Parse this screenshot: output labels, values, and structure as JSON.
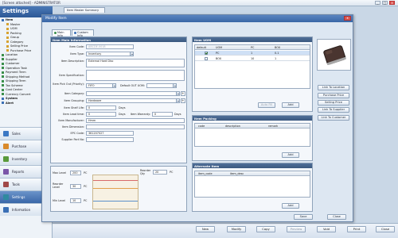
{
  "app": {
    "title": "[Screen attached] - ADMINISTRATOR",
    "min": "_",
    "max": "□",
    "close": "x"
  },
  "sidebar": {
    "header": "Settings",
    "tree": [
      {
        "label": "Item",
        "bold": true,
        "indent": 0,
        "color": "#3a6fb5"
      },
      {
        "label": "Master",
        "indent": 1,
        "color": "#d7a230"
      },
      {
        "label": "UOM",
        "indent": 1,
        "color": "#d7a230"
      },
      {
        "label": "Packing",
        "indent": 1,
        "color": "#d7a230"
      },
      {
        "label": "Group",
        "indent": 1,
        "color": "#d7a230"
      },
      {
        "label": "Category",
        "indent": 1,
        "color": "#d7a230"
      },
      {
        "label": "Selling Price",
        "indent": 1,
        "color": "#d7a230"
      },
      {
        "label": "Purchase Price",
        "indent": 1,
        "color": "#d7a230"
      },
      {
        "label": "Location",
        "indent": 0,
        "color": "#3a8f4a"
      },
      {
        "label": "Supplier",
        "indent": 0,
        "color": "#3a8f4a"
      },
      {
        "label": "Customer",
        "indent": 0,
        "color": "#3a8f4a"
      },
      {
        "label": "Operation Task",
        "indent": 0,
        "color": "#3a8f4a"
      },
      {
        "label": "Payment Term",
        "indent": 0,
        "color": "#3a8f4a"
      },
      {
        "label": "Shipping Method",
        "indent": 0,
        "color": "#3a8f4a"
      },
      {
        "label": "Shipping Term",
        "indent": 0,
        "color": "#3a8f4a"
      },
      {
        "label": "Tax Scheme",
        "indent": 0,
        "color": "#3a8f4a"
      },
      {
        "label": "Cost Center",
        "indent": 0,
        "color": "#3a8f4a"
      },
      {
        "label": "Currency Convert",
        "indent": 0,
        "color": "#3a8f4a"
      },
      {
        "label": "System",
        "bold": true,
        "indent": 0,
        "color": "#3a6fb5"
      },
      {
        "label": "Alert",
        "bold": true,
        "indent": 0,
        "color": "#3a6fb5"
      }
    ],
    "nav": [
      {
        "label": "Sales",
        "color": "#3b78c4"
      },
      {
        "label": "Purchase",
        "color": "#d98a2b"
      },
      {
        "label": "Inventory",
        "color": "#5a9a3b"
      },
      {
        "label": "Reports",
        "color": "#7a55a8"
      },
      {
        "label": "Tools",
        "color": "#a04848"
      },
      {
        "label": "Settings",
        "color": "#2f8aa0",
        "active": true
      },
      {
        "label": "Information",
        "color": "#3a6fb5"
      }
    ]
  },
  "background": {
    "tab": "Item Master Summary",
    "buttons": [
      {
        "label": "New",
        "disabled": false
      },
      {
        "label": "Modify",
        "disabled": false
      },
      {
        "label": "Copy",
        "disabled": false
      },
      {
        "label": "Preview",
        "disabled": true
      },
      {
        "label": "Void",
        "disabled": false
      },
      {
        "label": "Print",
        "disabled": false
      },
      {
        "label": "Close",
        "disabled": false
      }
    ]
  },
  "modal": {
    "title": "Modify Item",
    "tabs": [
      {
        "label": "Main Info",
        "active": true,
        "color": "#3a8f4a"
      },
      {
        "label": "Custom Info",
        "active": false,
        "color": "#3a6fb5"
      }
    ],
    "main_info": {
      "header": "Item Main Information",
      "item_code_label": "Item Code:",
      "item_code_value": "ABCDE-0018",
      "item_type_label": "Item Type:",
      "item_type_value": "Inventory",
      "item_desc_label": "Item Description:",
      "item_desc_value": "External Hard Disc",
      "item_spec_label": "Item Specification:",
      "pick_out_label": "Item Pick Out (Priority):",
      "pick_out_value": "FIFO",
      "default_uom_label": "Default OUT UOM:",
      "category_label": "Item Category:",
      "grouping_label": "Item Grouping:",
      "grouping_value": "Hardware",
      "shelf_life_label": "Item Shelf Life:",
      "shelf_life_value": "0",
      "days_1": "Days",
      "lead_time_label": "Item Lead time:",
      "lead_time_value": "0",
      "days_2": "Days",
      "warranty_label": "Item Warranty:",
      "warranty_value": "0",
      "days_3": "Days",
      "manufacturer_label": "Item Manufacturer:",
      "manufacturer_value": "Hmm",
      "dimension_label": "Item Dimension:",
      "epc_label": "EPC Code:",
      "epc_value": "361207027",
      "supplier_part_label": "Supplier Part No:"
    },
    "levels": {
      "max_label": "Max Level",
      "max_value": "200",
      "max_unit": "PC",
      "reorder_qty_label": "Reorder Qty",
      "reorder_qty_value": "20",
      "reorder_qty_unit": "PC",
      "reorder_level_label": "Reorder Level",
      "reorder_level_value": "30",
      "reorder_level_unit": "PC",
      "min_label": "Min Level",
      "min_value": "10",
      "min_unit": "PC"
    },
    "uom": {
      "header": "Item UOM",
      "columns": [
        "default",
        "UOM",
        "PC",
        "BOX"
      ],
      "rows": [
        {
          "checked": true,
          "uom": "PC",
          "pc": "1",
          "box": "0.1"
        },
        {
          "checked": false,
          "uom": "BOX",
          "pc": "10",
          "box": "1"
        }
      ],
      "auto_fill": "Auto Fill",
      "add": "Add"
    },
    "packing": {
      "header": "Item Packing",
      "columns": [
        "code",
        "description",
        "remark"
      ],
      "add": "Add"
    },
    "alternate": {
      "header": "Alternate Item",
      "columns": [
        "item_code",
        "item_desc"
      ],
      "add": "Add"
    },
    "side_buttons": [
      "Link To Location",
      "Purchase Price",
      "Selling Price",
      "Link To Supplier",
      "Link To Customer"
    ],
    "save": "Save",
    "close": "Close"
  }
}
